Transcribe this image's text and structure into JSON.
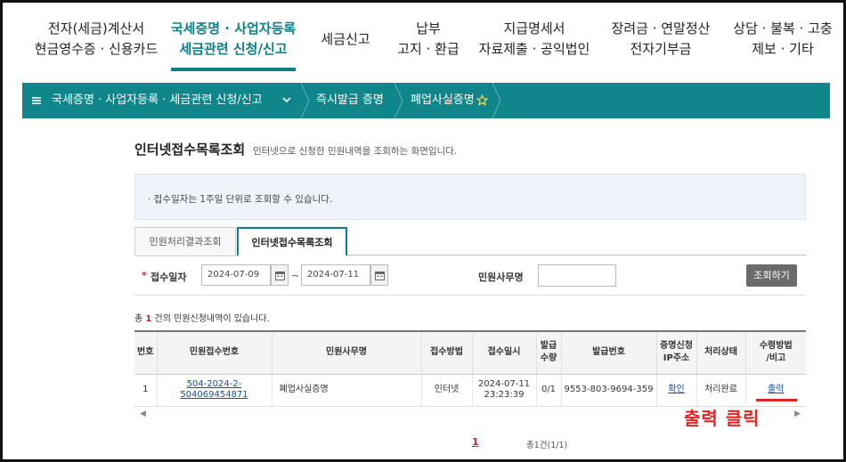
{
  "topnav": [
    {
      "line1": "전자(세금)계산서",
      "line2": "현금영수증 · 신용카드"
    },
    {
      "line1": "국세증명 · 사업자등록",
      "line2": "세금관련 신청/신고"
    },
    {
      "line1": "세금신고",
      "line2": ""
    },
    {
      "line1": "납부",
      "line2": "고지 · 환급"
    },
    {
      "line1": "지급명세서",
      "line2": "자료제출 · 공익법인"
    },
    {
      "line1": "장려금 · 연말정산",
      "line2": "전자기부금"
    },
    {
      "line1": "상담 · 불복 · 고충",
      "line2": "제보 · 기타"
    }
  ],
  "breadcrumb": {
    "menu_icon": "hamburger-icon",
    "level1": "국세증명 · 사업자등록 · 세금관련 신청/신고",
    "level2": "즉시발급 증명",
    "level3": "폐업사실증명",
    "favorite_icon": "star-outline-icon"
  },
  "page": {
    "title": "인터넷접수목록조회",
    "description": "인터넷으로 신청한 민원내역을 조회하는 화면입니다.",
    "notice": "· 접수일자는 1주일 단위로 조회할 수 있습니다."
  },
  "tabs": [
    {
      "label": "민원처리결과조회",
      "active": false
    },
    {
      "label": "인터넷접수목록조회",
      "active": true
    }
  ],
  "search": {
    "required_mark": "*",
    "date_label": "접수일자",
    "date_from": "2024-07-09",
    "date_to": "2024-07-11",
    "range_sep": "~",
    "service_label": "민원사무명",
    "service_value": "",
    "button": "조회하기"
  },
  "result": {
    "prefix": "총 ",
    "count": "1",
    "suffix": " 건의 민원신청내역이 있습니다."
  },
  "table": {
    "headers": [
      "번호",
      "민원접수번호",
      "민원사무명",
      "접수방법",
      "접수일시",
      "발급\n수량",
      "발급번호",
      "증명신청\nIP주소",
      "처리상태",
      "수령방법\n/비고"
    ],
    "rows": [
      [
        "1",
        "504-2024-2-504069454871",
        "폐업사실증명",
        "인터넷",
        "2024-07-11\n23:23:39",
        "0/1",
        "9553-803-9694-359",
        "확인",
        "처리완료",
        "출력"
      ]
    ]
  },
  "annotation": "출력 클릭",
  "pagination": {
    "current": "1",
    "total": "총1건(1/1)"
  }
}
